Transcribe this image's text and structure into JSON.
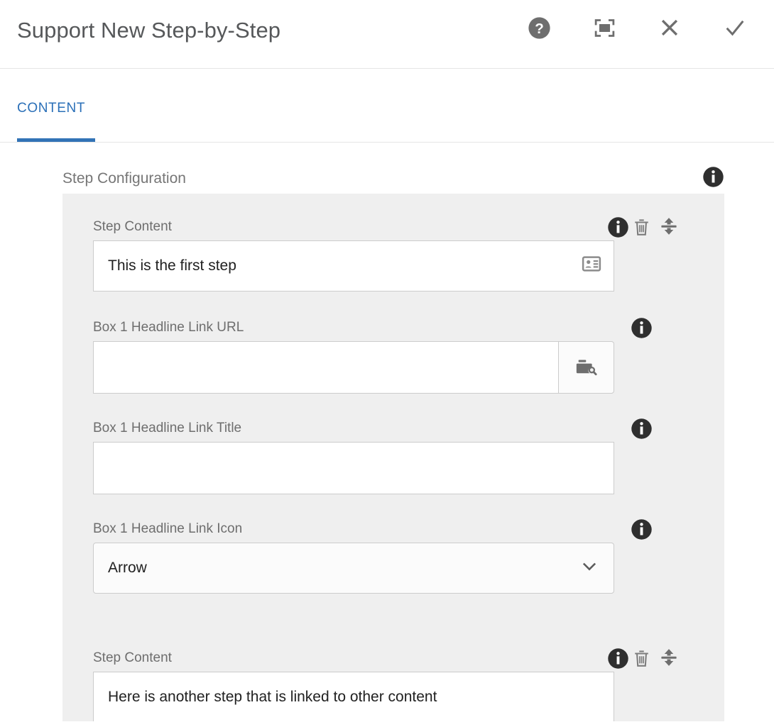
{
  "header": {
    "title": "Support New Step-by-Step",
    "actions": [
      {
        "name": "help-icon",
        "label": "Help"
      },
      {
        "name": "fullscreen-icon",
        "label": "Toggle Fullscreen"
      },
      {
        "name": "close-icon",
        "label": "Cancel"
      },
      {
        "name": "check-icon",
        "label": "Done"
      }
    ]
  },
  "tabs": [
    {
      "label": "CONTENT",
      "active": true
    }
  ],
  "colors": {
    "tab_active": "#2b70b8",
    "tab_underline": "#3273b6",
    "panel_bg": "#efefef",
    "page_bg": "#ffffff",
    "label_text": "#6e6e6e",
    "title_text": "#56585a",
    "input_border": "#cccccc",
    "icon_gray": "#6e6e6e",
    "info_badge": "#333333"
  },
  "main": {
    "section_title": "Step Configuration",
    "section_info_icon": "info-icon",
    "fields": [
      {
        "label": "Step Content",
        "value": "This is the first step",
        "placeholder": "",
        "type": "text",
        "inline_icon": "contact-card-icon",
        "has_info": true,
        "has_delete": true,
        "has_drag": true
      },
      {
        "label": "Box 1 Headline Link URL",
        "value": "",
        "placeholder": "",
        "type": "text-with-browse",
        "browse_icon": "folder-search-icon",
        "has_info": true,
        "has_delete": false,
        "has_drag": false
      },
      {
        "label": "Box 1 Headline Link Title",
        "value": "",
        "placeholder": "",
        "type": "text",
        "has_info": true,
        "has_delete": false,
        "has_drag": false
      },
      {
        "label": "Box 1 Headline Link Icon",
        "value": "Arrow",
        "placeholder": "",
        "type": "select",
        "has_info": true,
        "has_delete": false,
        "has_drag": false
      },
      {
        "label": "Step Content",
        "value": "Here is another step that is linked to other content",
        "placeholder": "",
        "type": "text",
        "has_info": true,
        "has_delete": true,
        "has_drag": true
      }
    ]
  }
}
